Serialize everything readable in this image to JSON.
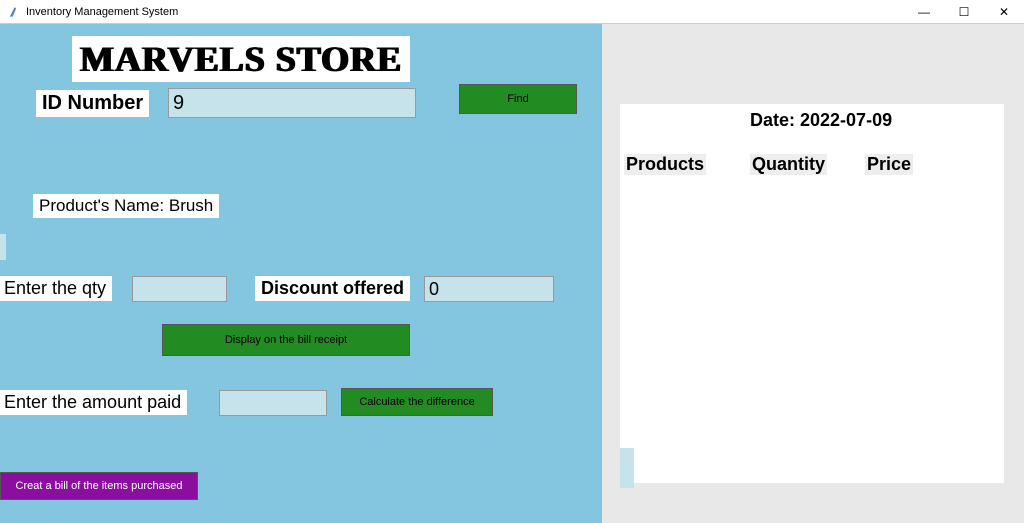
{
  "window": {
    "title": "Inventory Management System"
  },
  "storeTitle": "MARVELS STORE",
  "idLabel": "ID Number",
  "idValue": "9",
  "findBtn": "Find",
  "productNameLabel": "Product's Name: Brush",
  "qtyLabel": "Enter the qty",
  "qtyValue": "",
  "discountLabel": "Discount offered",
  "discountValue": "0",
  "displayBtn": "Display on the bill receipt",
  "amountPaidLabel": "Enter the amount paid",
  "amountPaidValue": "",
  "calcBtn": "Calculate the difference",
  "creatBillBtn": "Creat a bill of the items purchased",
  "receipt": {
    "dateLabel": "Date: 2022-07-09",
    "productsHeader": "Products",
    "quantityHeader": "Quantity",
    "priceHeader": "Price"
  }
}
